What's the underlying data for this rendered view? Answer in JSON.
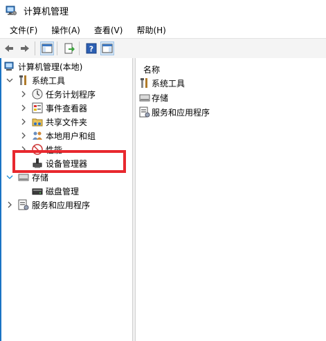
{
  "window": {
    "title": "计算机管理",
    "icon": "computer-management-icon"
  },
  "menu": {
    "file": "文件(F)",
    "action": "操作(A)",
    "view": "查看(V)",
    "help": "帮助(H)"
  },
  "toolbar": {
    "icons": [
      "back-arrow-icon",
      "forward-arrow-icon",
      "show-hide-tree-icon",
      "export-list-icon",
      "help-icon",
      "properties-icon"
    ]
  },
  "tree": {
    "root": "计算机管理(本地)",
    "system_tools": "系统工具",
    "task_scheduler": "任务计划程序",
    "event_viewer": "事件查看器",
    "shared_folders": "共享文件夹",
    "local_users": "本地用户和组",
    "performance": "性能",
    "device_manager": "设备管理器",
    "storage": "存储",
    "disk_management": "磁盘管理",
    "services_apps": "服务和应用程序"
  },
  "list": {
    "column_name": "名称",
    "items": [
      "系统工具",
      "存储",
      "服务和应用程序"
    ]
  },
  "colors": {
    "highlight": "#e8282e",
    "accent": "#1a73c4"
  }
}
